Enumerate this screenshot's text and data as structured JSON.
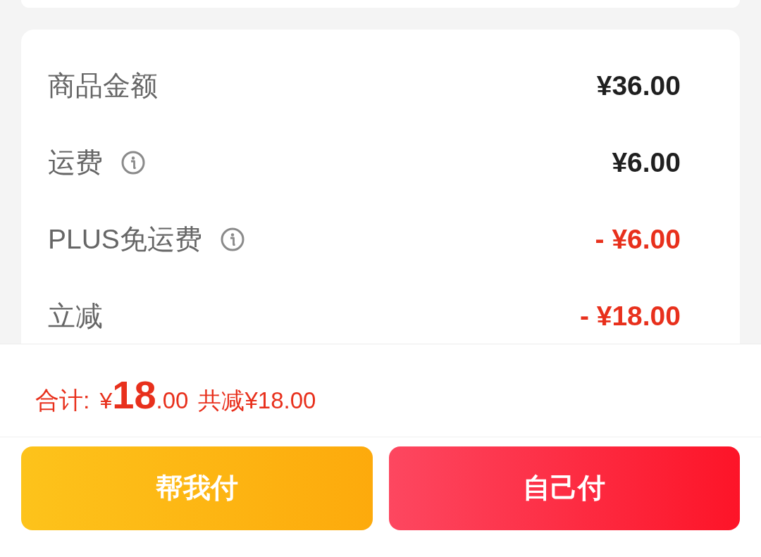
{
  "summary": {
    "rows": [
      {
        "label": "商品金额",
        "info": false,
        "kind": "charge",
        "value": "¥36.00"
      },
      {
        "label": "运费",
        "info": true,
        "kind": "charge",
        "value": "¥6.00"
      },
      {
        "label": "PLUS免运费",
        "info": true,
        "kind": "discount",
        "value": "- ¥6.00"
      },
      {
        "label": "立减",
        "info": false,
        "kind": "discount",
        "value": "- ¥18.00"
      }
    ]
  },
  "total": {
    "label": "合计:",
    "currency": "¥",
    "amount_integer": "18",
    "amount_decimal": ".00",
    "savings": "共减¥18.00"
  },
  "buttons": [
    {
      "label": "帮我付",
      "kind": "secondary"
    },
    {
      "label": "自己付",
      "kind": "primary"
    }
  ]
}
